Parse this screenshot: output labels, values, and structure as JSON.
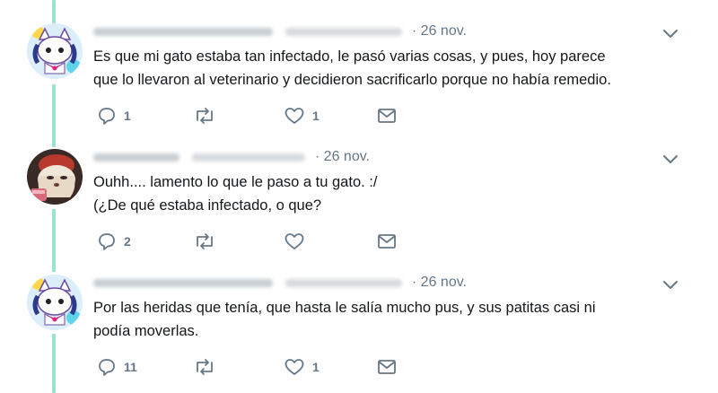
{
  "colors": {
    "thread_line": "#9be3cf",
    "muted": "#657786",
    "text": "#14171a"
  },
  "tweets": [
    {
      "date": "· 26 nov.",
      "text_lines": [
        "Es que mi gato estaba tan infectado, le pasó varias cosas, y pues, hoy parece",
        "que lo llevaron al veterinario y decidieron sacrificarlo porque no había remedio."
      ],
      "reply_count": "1",
      "retweet_count": "",
      "like_count": "1"
    },
    {
      "date": "· 26 nov.",
      "text_lines": [
        "Ouhh.... lamento lo que le paso a tu gato. :/",
        "(¿De qué estaba infectado, o que?"
      ],
      "reply_count": "2",
      "retweet_count": "",
      "like_count": ""
    },
    {
      "date": "· 26 nov.",
      "text_lines": [
        "Por las heridas que tenía, que hasta le salía mucho pus, y sus patitas casi ni",
        "podía moverlas."
      ],
      "reply_count": "11",
      "retweet_count": "",
      "like_count": "1"
    }
  ],
  "icons": {
    "reply": "reply-icon",
    "retweet": "retweet-icon",
    "like": "heart-icon",
    "dm": "envelope-icon",
    "more": "chevron-down-icon"
  }
}
